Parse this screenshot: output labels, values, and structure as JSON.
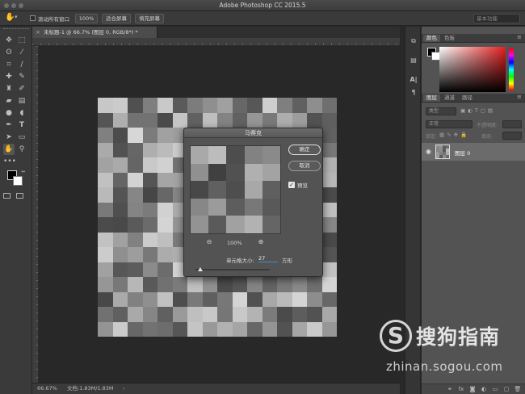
{
  "app": {
    "title": "Adobe Photoshop CC 2015.5"
  },
  "options_bar": {
    "scroll_all_windows": "滚动所有窗口",
    "zoom_100": "100%",
    "fit_screen": "适合屏幕",
    "fill_screen": "填充屏幕",
    "workspace": "基本功能"
  },
  "document": {
    "tab_title": "未标题-1 @ 66.7% (图层 0, RGB/8*) *"
  },
  "status": {
    "zoom": "66.67%",
    "doc_size": "文档:1.83M/1.83M"
  },
  "dialog": {
    "title": "马赛克",
    "ok": "确定",
    "cancel": "取消",
    "preview_label": "预览",
    "preview_checked": true,
    "zoom": "100%",
    "cell_size_label": "单元格大小:",
    "cell_size_value": "27",
    "cell_size_unit": "方形"
  },
  "panels": {
    "color_tabs": [
      "颜色",
      "色板"
    ],
    "layers_tabs": [
      "图层",
      "通道",
      "路径"
    ],
    "kind_filter": "类型",
    "blend_mode": "正常",
    "opacity_label": "不透明度:",
    "lock_label": "锁定:",
    "fill_label": "填充:",
    "layer_name": "图层 0"
  },
  "watermark": {
    "logo_glyph": "S",
    "brand": "搜狗指南",
    "url": "zhinan.sogou.com"
  },
  "colors": {
    "foreground": "#000000",
    "background": "#ffffff",
    "picker_hue": "#e51e1e"
  },
  "icons": [
    "hand-icon",
    "move-icon",
    "marquee-icon",
    "lasso-icon",
    "magic-wand-icon",
    "crop-icon",
    "eyedropper-icon",
    "healing-icon",
    "brush-icon",
    "stamp-icon",
    "history-brush-icon",
    "eraser-icon",
    "gradient-icon",
    "blur-icon",
    "dodge-icon",
    "pen-icon",
    "type-icon",
    "path-select-icon",
    "rectangle-icon",
    "zoom-icon",
    "more-icon",
    "zoom-in-icon",
    "zoom-out-icon",
    "eye-icon"
  ]
}
